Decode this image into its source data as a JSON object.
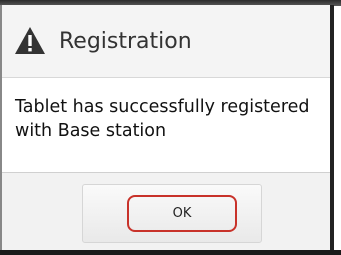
{
  "dialog": {
    "title": "Registration",
    "title_icon": "warning-icon",
    "message": "Tablet has successfully registered with Base station",
    "ok_label": "OK"
  },
  "colors": {
    "title_bar": "#f4f4f4",
    "footer": "#f2f2f2",
    "highlight_outline": "#c8322a",
    "text": "#111111"
  }
}
